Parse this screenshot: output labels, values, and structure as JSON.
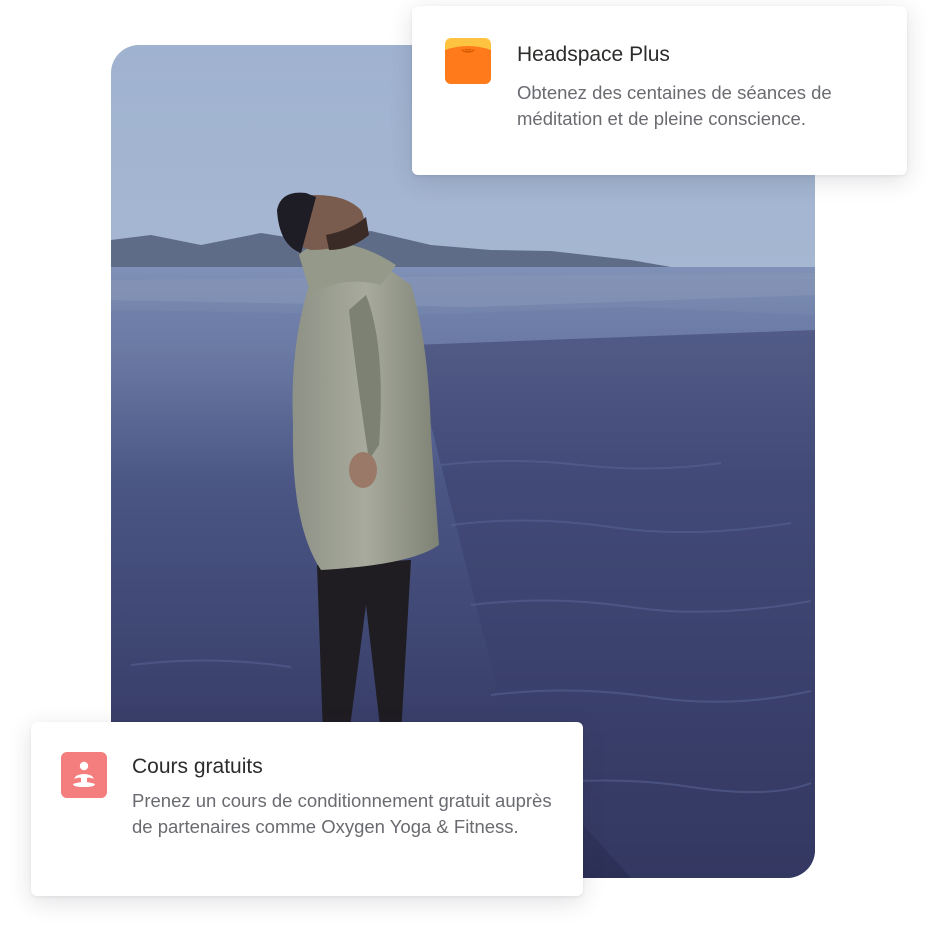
{
  "photo": {
    "description_icon": "person-beach-photo"
  },
  "headspace_card": {
    "icon": "headspace-plus-icon",
    "icon_colors": [
      "#ffc342",
      "#ff7a1a"
    ],
    "title": "Headspace Plus",
    "description": "Obtenez des centaines de séances de méditation et de pleine conscience."
  },
  "classes_card": {
    "icon": "meditation-person-icon",
    "icon_color": "#f47d7d",
    "title": "Cours gratuits",
    "description": "Prenez un cours de conditionnement gratuit auprès de partenaires comme Oxygen Yoga & Fitness."
  }
}
